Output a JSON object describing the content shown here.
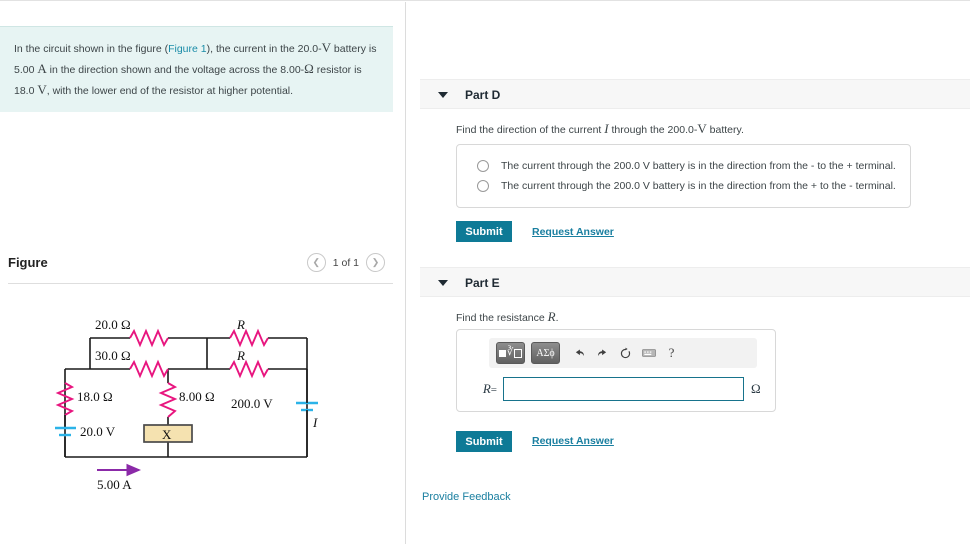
{
  "problem": {
    "text_lead": "In the circuit shown in the figure (",
    "figure_link": "Figure 1",
    "text_a": "), the current in the 20.0-",
    "v1": "V",
    "text_b": " battery is",
    "line2_a": "5.00 ",
    "amp": "A",
    "line2_b": " in the direction shown and the voltage across the 8.00-",
    "ohm": "Ω",
    "line2_c": " resistor is",
    "line3_a": "18.0 ",
    "v2": "V",
    "line3_b": ", with the lower end of the resistor at higher potential."
  },
  "figure_panel": {
    "title": "Figure",
    "prev_icon": "chevron-left-icon",
    "next_icon": "chevron-right-icon",
    "counter": "1 of 1"
  },
  "circuit": {
    "labels": {
      "r_top_left": "20.0 Ω",
      "r_top_right": "R",
      "r_mid_left": "30.0 Ω",
      "r_mid_right": "R",
      "r_left_branch": "18.0 Ω",
      "r_mid_branch": "8.00 Ω",
      "battery_left": "20.0 V",
      "battery_right": "200.0 V",
      "box_label": "X",
      "current_bottom": "5.00 A",
      "current_right": "I"
    },
    "colors": {
      "resistor": "#e8157f",
      "battery": "#2bb3e8",
      "wire": "#1a1a1a",
      "box_fill": "#f5e2b0",
      "arrow": "#8b2aa8"
    }
  },
  "parts": [
    {
      "id": "part-d",
      "label": "Part D",
      "caret_icon": "caret-down-icon",
      "prompt_a": "Find the direction of the current ",
      "prompt_var": "I",
      "prompt_b": " through the 200.0-",
      "prompt_v": "V",
      "prompt_c": " battery.",
      "choices": [
        "The current through the 200.0 V battery is in the direction from the - to the + terminal.",
        "The current through the 200.0 V battery is in the direction from the + to the - terminal."
      ],
      "submit_label": "Submit",
      "request_answer_label": "Request Answer"
    },
    {
      "id": "part-e",
      "label": "Part E",
      "caret_icon": "caret-down-icon",
      "prompt_a": "Find the resistance ",
      "prompt_var": "R",
      "prompt_c": ".",
      "toolbar": {
        "template_button": "template-icon",
        "greek_button": "ΑΣϕ",
        "undo_icon": "undo-icon",
        "redo_icon": "redo-icon",
        "reset_icon": "reset-icon",
        "keyboard_icon": "keyboard-icon",
        "help_label": "?"
      },
      "answer": {
        "variable": "R",
        "equals": "=",
        "value": "",
        "placeholder": "",
        "unit": "Ω"
      },
      "submit_label": "Submit",
      "request_answer_label": "Request Answer"
    }
  ],
  "footer": {
    "feedback_label": "Provide Feedback"
  },
  "theme": {
    "accent": "#0e7a96",
    "link": "#1a7fa0",
    "problem_bg": "#e7f4f3",
    "band_bg": "#f7f7f7"
  }
}
